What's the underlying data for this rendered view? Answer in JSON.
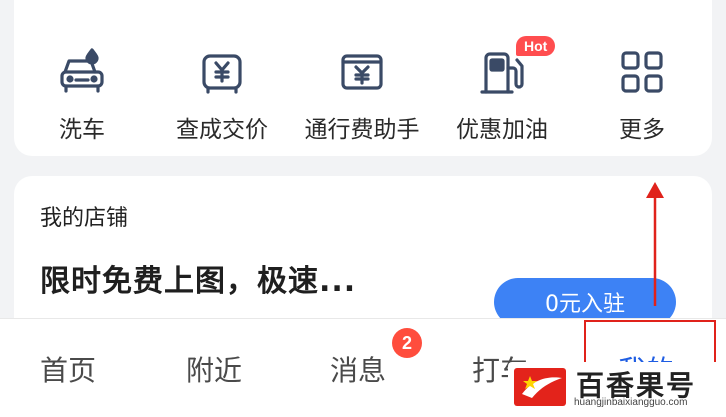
{
  "services": {
    "items": [
      {
        "label": "洗车",
        "icon": "car-wash-icon"
      },
      {
        "label": "查成交价",
        "icon": "car-price-icon"
      },
      {
        "label": "通行费助手",
        "icon": "toll-fee-icon"
      },
      {
        "label": "优惠加油",
        "icon": "fuel-pump-icon",
        "badge": "Hot"
      },
      {
        "label": "更多",
        "icon": "grid-more-icon"
      }
    ]
  },
  "shop": {
    "title": "我的店铺",
    "description": "限时免费上图，极速...",
    "join_button": "0元入驻"
  },
  "tabbar": {
    "tabs": [
      {
        "label": "首页"
      },
      {
        "label": "附近"
      },
      {
        "label": "消息",
        "badge": "2"
      },
      {
        "label": "打车"
      },
      {
        "label": "我的",
        "active": true
      }
    ]
  },
  "watermark": {
    "text": "百香果号",
    "url": "huangjinbaixiangguo.com"
  },
  "colors": {
    "accent": "#3d82f5",
    "active_tab": "#1e5de3",
    "hot_badge": "#ff4d4f",
    "highlight": "#e0221b"
  }
}
